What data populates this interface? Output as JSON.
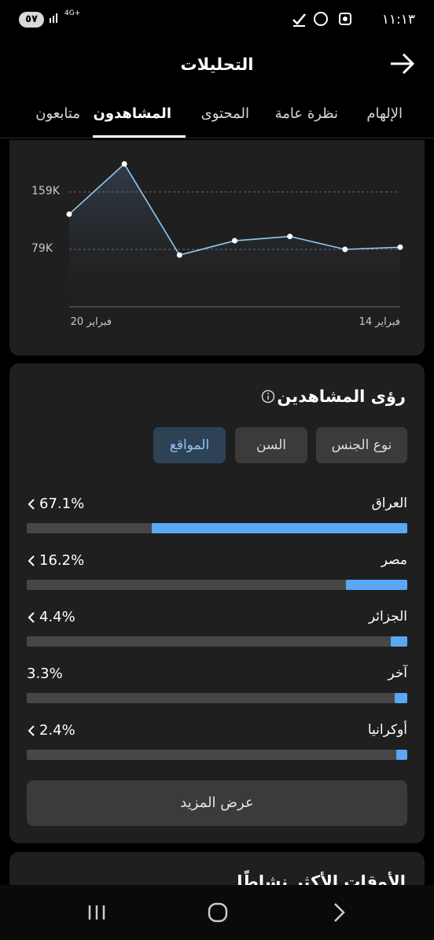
{
  "status_bar": {
    "battery": "٥٧",
    "network": "4G+",
    "time": "١١:١٣"
  },
  "header": {
    "title": "التحليلات"
  },
  "tabs": [
    {
      "label": "الإلهام",
      "active": false
    },
    {
      "label": "نظرة عامة",
      "active": false
    },
    {
      "label": "المحتوى",
      "active": false
    },
    {
      "label": "المشاهدون",
      "active": true
    },
    {
      "label": "متابعون",
      "active": false
    }
  ],
  "chart_data": {
    "type": "area",
    "x_labels": [
      "فبراير 14",
      "فبراير 20"
    ],
    "ytick_labels": [
      "159K",
      "79K"
    ],
    "values": [
      128000,
      198000,
      71000,
      91000,
      97000,
      79000,
      82000
    ],
    "grid": "dashed horizontal"
  },
  "insights": {
    "title": "رؤى المشاهدين",
    "filters": [
      {
        "label": "نوع الجنس",
        "active": false
      },
      {
        "label": "السن",
        "active": false
      },
      {
        "label": "المواقع",
        "active": true
      }
    ],
    "locations": [
      {
        "name": "العراق",
        "percent": "67.1%",
        "value": 67.1,
        "chevron": true
      },
      {
        "name": "مصر",
        "percent": "16.2%",
        "value": 16.2,
        "chevron": true
      },
      {
        "name": "الجزائر",
        "percent": "4.4%",
        "value": 4.4,
        "chevron": true
      },
      {
        "name": "آخر",
        "percent": "3.3%",
        "value": 3.3,
        "chevron": false
      },
      {
        "name": "أوكرانيا",
        "percent": "2.4%",
        "value": 2.4,
        "chevron": true
      }
    ],
    "more_label": "عرض المزيد"
  },
  "next_card": {
    "title": "الأوقات الأكثر نشاطًا"
  },
  "colors": {
    "accent": "#5aa8f5",
    "card": "#1f1f1f",
    "pill": "#3b3b3b",
    "pill_active": "#2e4256"
  }
}
